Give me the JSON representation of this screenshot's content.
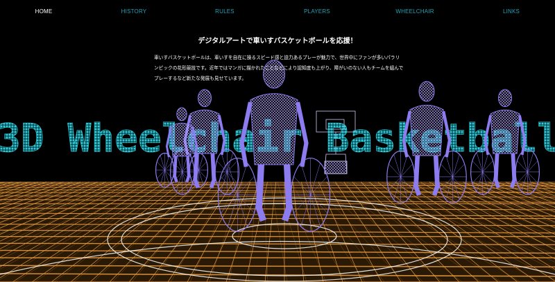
{
  "nav": {
    "items": [
      {
        "label": "HOME",
        "active": true
      },
      {
        "label": "HISTORY",
        "active": false
      },
      {
        "label": "RULES",
        "active": false
      },
      {
        "label": "PLAYERS",
        "active": false
      },
      {
        "label": "WHEELCHAIR",
        "active": false
      },
      {
        "label": "LINKS",
        "active": false
      }
    ]
  },
  "intro": {
    "heading": "デジタルアートで車いすバスケットボールを応援！",
    "body": "車いすバスケットボールは、車いすを自在に操るスピード感と迫力あるプレーが魅力で、世界中にファンが多いパラリンピックの花形競技です。近年ではマンガに描かれたことなどにより認知度も上がり、障がいのない人もチームを組んでプレーするなど新たな発展も見せています。"
  },
  "hero": {
    "title": "3D Wheelchair Basketball"
  },
  "colors": {
    "background": "#000000",
    "nav_link": "#1ea3b6",
    "nav_active": "#ffffff",
    "title": "#2ad0e0",
    "floor_grid": "#f0a040",
    "court_lines": "#ffffff",
    "players": "#8c7cf0"
  }
}
